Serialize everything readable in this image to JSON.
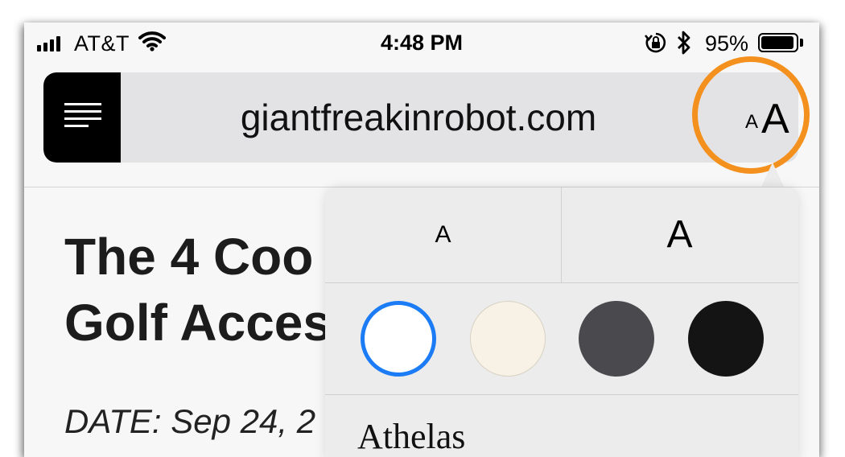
{
  "status_bar": {
    "carrier": "AT&T",
    "time": "4:48 PM",
    "battery_percent": "95%",
    "battery_level": 0.95,
    "icons": [
      "signal-icon",
      "wifi-icon",
      "rotation-lock-icon",
      "bluetooth-icon",
      "battery-icon"
    ]
  },
  "url_bar": {
    "url": "giantfreakinrobot.com",
    "reader_icon": "reader-view-icon",
    "text_size_small": "A",
    "text_size_large": "A",
    "highlight_color": "#f4901e"
  },
  "article": {
    "title_line1": "The 4 Coo",
    "title_line2": "Golf Acces",
    "date": "DATE: Sep 24, 2"
  },
  "reader_options": {
    "smaller_text": "A",
    "larger_text": "A",
    "themes": [
      {
        "name": "white",
        "color": "#ffffff",
        "selected": true
      },
      {
        "name": "sepia",
        "color": "#f8f2e6",
        "selected": false
      },
      {
        "name": "gray",
        "color": "#4a494e",
        "selected": false
      },
      {
        "name": "night",
        "color": "#141414",
        "selected": false
      }
    ],
    "selection_color": "#1b7cf5",
    "font": "Athelas"
  }
}
